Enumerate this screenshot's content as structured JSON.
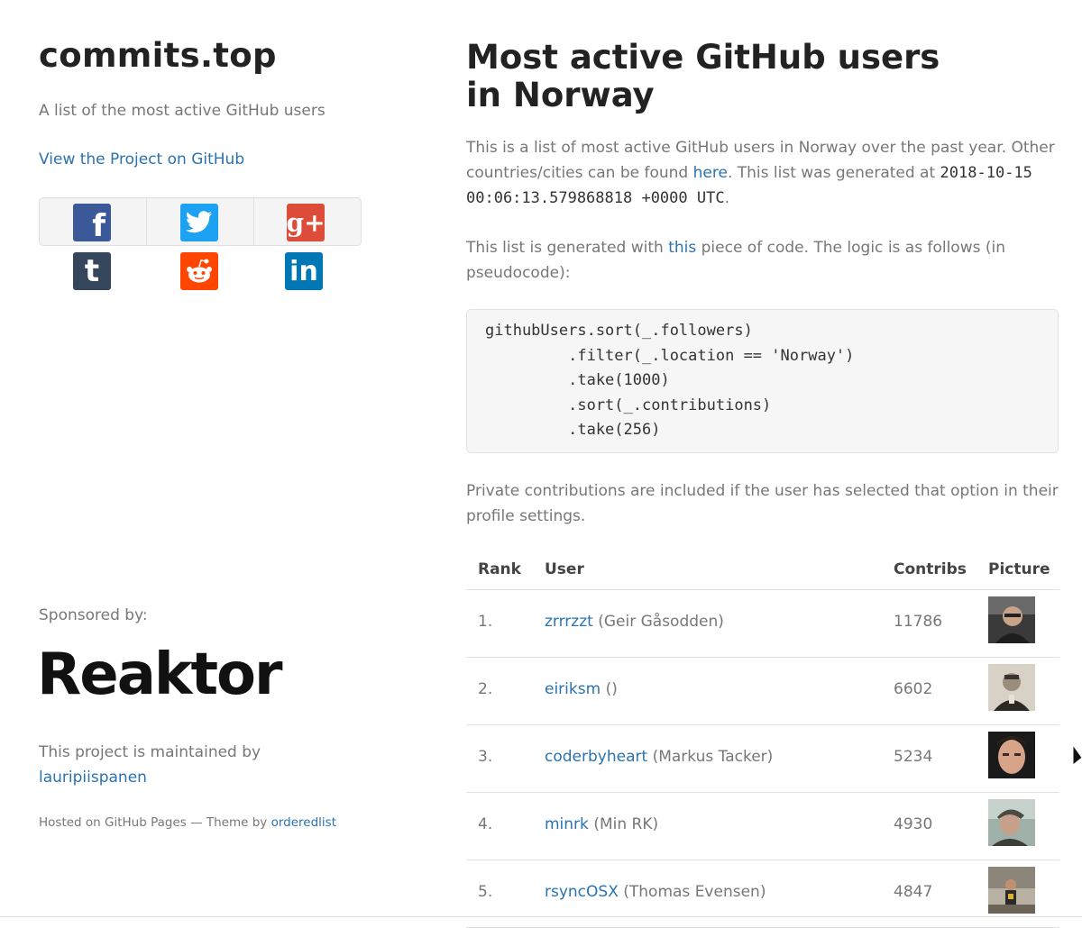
{
  "sidebar": {
    "title": "commits.top",
    "tagline": "A list of the most active GitHub users",
    "project_link": "View the Project on GitHub",
    "share_icons": [
      {
        "name": "facebook-icon",
        "glyph": "f",
        "color": "#3b5998"
      },
      {
        "name": "twitter-icon",
        "glyph": "",
        "color": "#1da1f2"
      },
      {
        "name": "google-plus-icon",
        "glyph": "g+",
        "color": "#dd4b39"
      },
      {
        "name": "tumblr-icon",
        "glyph": "t",
        "color": "#35465c"
      },
      {
        "name": "reddit-icon",
        "glyph": "",
        "color": "#ff4500"
      },
      {
        "name": "linkedin-icon",
        "glyph": "in",
        "color": "#0077b5"
      }
    ],
    "sponsored_label": "Sponsored by:",
    "sponsor_logo": "Reaktor",
    "maintained_prefix": "This project is maintained by",
    "maintainer": "lauripiispanen",
    "hosted_prefix": "Hosted on GitHub Pages — Theme by",
    "theme_author": "orderedlist"
  },
  "main": {
    "heading": "Most active GitHub users in Norway",
    "intro_1": "This is a list of most active GitHub users in Norway over the past year. Other countries/cities can be found",
    "intro_link": "here",
    "intro_2": ". This list was generated at",
    "generated_at": "2018-10-15 00:06:13.579868818 +0000 UTC",
    "intro_end": ".",
    "logic_1": "This list is generated with",
    "logic_link": "this",
    "logic_2": "piece of code. The logic is as follows (in pseudocode):",
    "code_lines": [
      "githubUsers.sort(_.followers)",
      "         .filter(_.location == 'Norway')",
      "         .take(1000)",
      "         .sort(_.contributions)",
      "         .take(256)"
    ],
    "private_note": "Private contributions are included if the user has selected that option in their profile settings.",
    "table": {
      "headers": [
        "Rank",
        "User",
        "Contribs",
        "Picture"
      ],
      "rows": [
        {
          "rank": "1.",
          "user": "zrrrzzt",
          "name": "(Geir Gåsodden)",
          "contribs": "11786"
        },
        {
          "rank": "2.",
          "user": "eiriksm",
          "name": "()",
          "contribs": "6602"
        },
        {
          "rank": "3.",
          "user": "coderbyheart",
          "name": "(Markus Tacker)",
          "contribs": "5234"
        },
        {
          "rank": "4.",
          "user": "minrk",
          "name": "(Min RK)",
          "contribs": "4930"
        },
        {
          "rank": "5.",
          "user": "rsyncOSX",
          "name": "(Thomas Evensen)",
          "contribs": "4847"
        }
      ]
    }
  },
  "colors": {
    "link": "#2a73b2",
    "heading": "#222222",
    "body_text": "#777777"
  }
}
